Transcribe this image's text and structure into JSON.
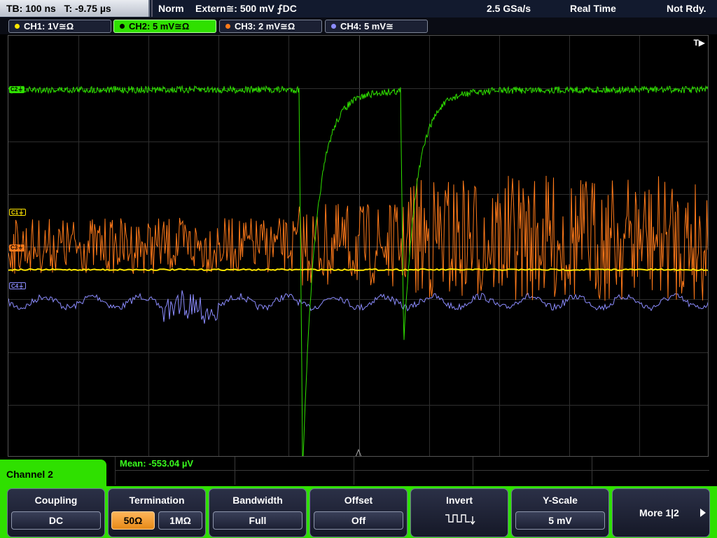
{
  "status_bar": {
    "timebase": "TB: 100 ns",
    "trigger_time": "T: -9.75 µs",
    "trigger_mode": "Norm",
    "trigger_source": "Extern≅: 500 mV ⨍DC",
    "sample_rate": "2.5 GSa/s",
    "acq_mode": "Real Time",
    "acq_state": "Not Rdy."
  },
  "channels": [
    {
      "label": "CH1: 1V≅Ω",
      "color": "#ffe600",
      "marker": "C1⏚"
    },
    {
      "label": "CH2: 5 mV≅Ω",
      "color": "#2fe000",
      "marker": "C2⏚"
    },
    {
      "label": "CH3: 2 mV≅Ω",
      "color": "#ff7a1a",
      "marker": "C3⏚"
    },
    {
      "label": "CH4: 5 mV≅",
      "color": "#8c8cff",
      "marker": "C4⏚"
    }
  ],
  "trigger_marker": "T▶",
  "measurement": {
    "mean": "Mean: -553.04 µV"
  },
  "menu": {
    "title": "Channel 2",
    "coupling": {
      "title": "Coupling",
      "value": "DC"
    },
    "termination": {
      "title": "Termination",
      "opt1": "50Ω",
      "opt2": "1MΩ"
    },
    "bandwidth": {
      "title": "Bandwidth",
      "value": "Full"
    },
    "offset": {
      "title": "Offset",
      "value": "Off"
    },
    "invert": {
      "title": "Invert",
      "icon": "inverted-waveform-icon"
    },
    "yscale": {
      "title": "Y-Scale",
      "value": "5 mV"
    },
    "more": {
      "label": "More 1|2",
      "icon": "arrow-right-icon"
    }
  }
}
